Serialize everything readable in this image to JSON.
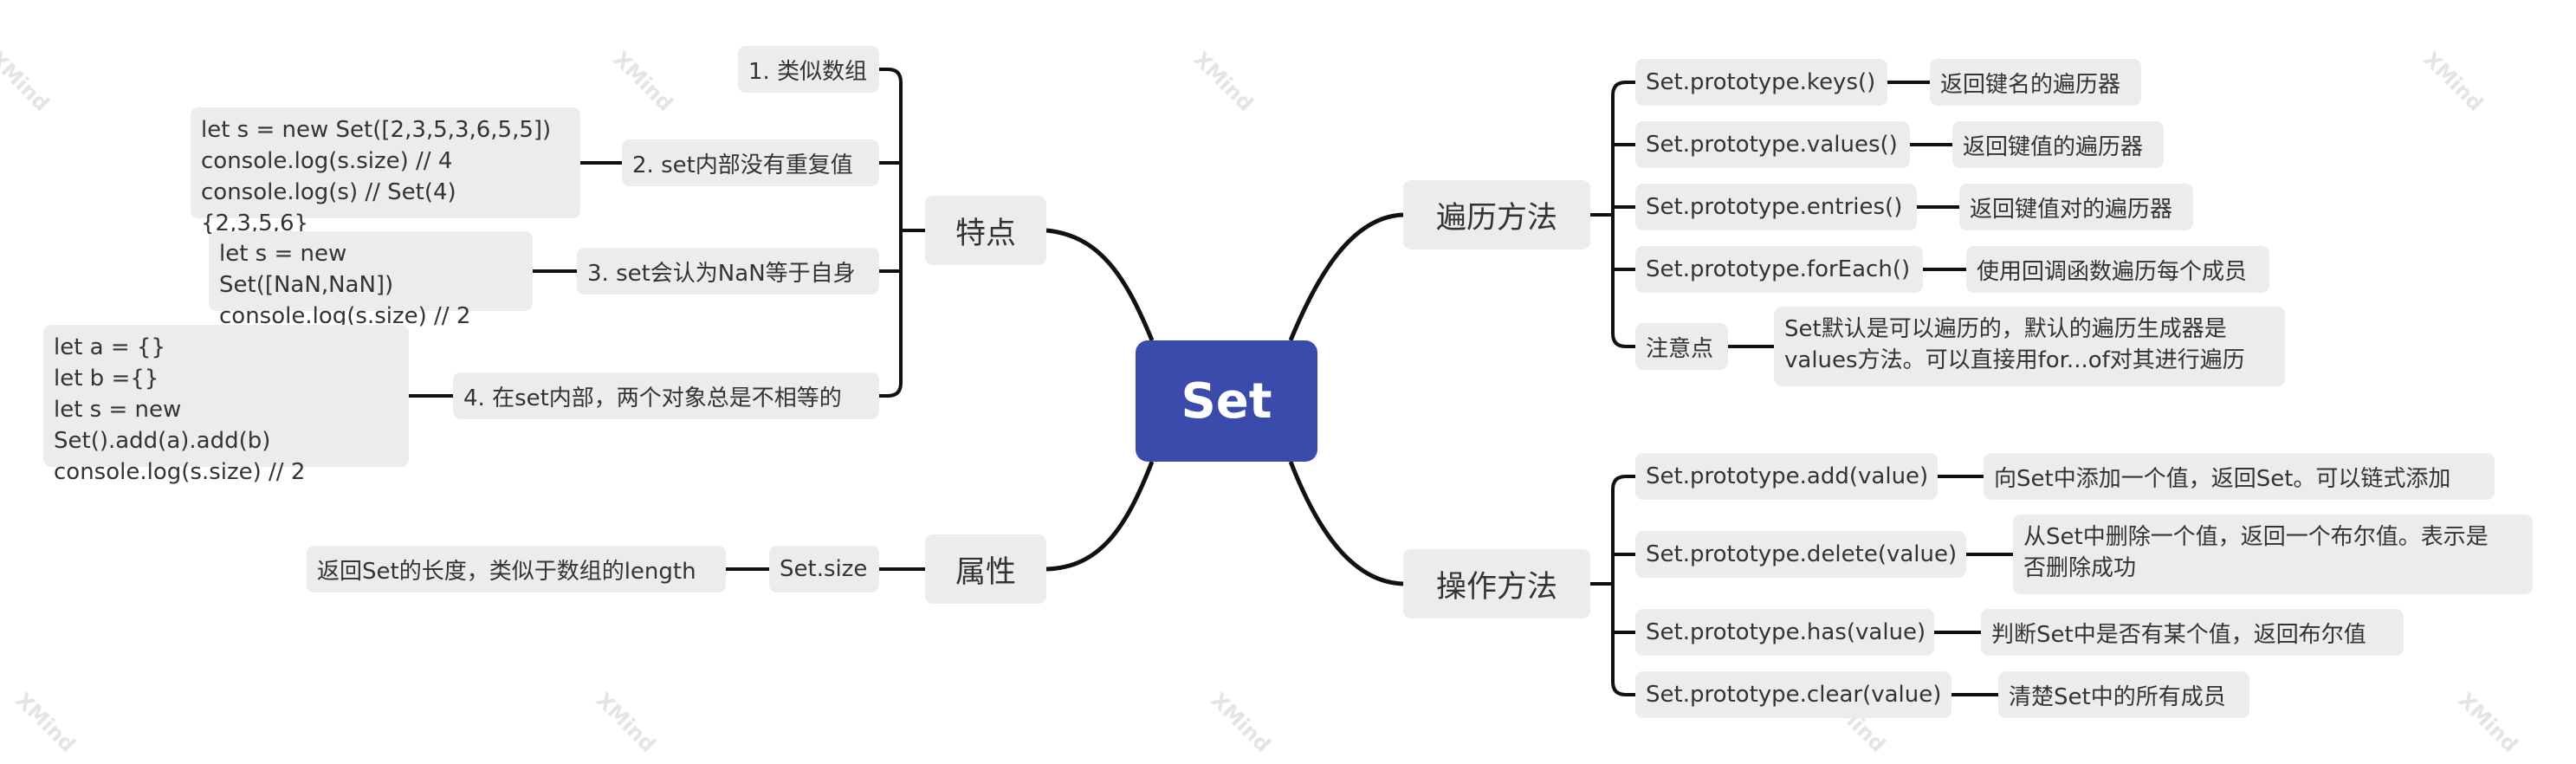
{
  "root": {
    "label": "Set"
  },
  "branches": {
    "tedian": {
      "label": "特点",
      "items": [
        {
          "label": "1. 类似数组"
        },
        {
          "label": "2. set内部没有重复值",
          "example": "let s = new Set([2,3,5,3,6,5,5])\nconsole.log(s.size) // 4\nconsole.log(s) // Set(4) {2,3,5,6}"
        },
        {
          "label": "3. set会认为NaN等于自身",
          "example": "let s = new Set([NaN,NaN])\nconsole.log(s.size) // 2"
        },
        {
          "label": "4. 在set内部，两个对象总是不相等的",
          "example": "let a = {}\nlet b ={}\nlet s = new Set().add(a).add(b)\nconsole.log(s.size) // 2"
        }
      ]
    },
    "shuxing": {
      "label": "属性",
      "items": [
        {
          "label": "Set.size",
          "desc": "返回Set的长度，类似于数组的length"
        }
      ]
    },
    "bianli": {
      "label": "遍历方法",
      "items": [
        {
          "label": "Set.prototype.keys()",
          "desc": "返回键名的遍历器"
        },
        {
          "label": "Set.prototype.values()",
          "desc": "返回键值的遍历器"
        },
        {
          "label": "Set.prototype.entries()",
          "desc": "返回键值对的遍历器"
        },
        {
          "label": "Set.prototype.forEach()",
          "desc": "使用回调函数遍历每个成员"
        },
        {
          "label": "注意点",
          "desc": "Set默认是可以遍历的，默认的遍历生成器是\nvalues方法。可以直接用for...of对其进行遍历"
        }
      ]
    },
    "caozuo": {
      "label": "操作方法",
      "items": [
        {
          "label": "Set.prototype.add(value)",
          "desc": "向Set中添加一个值，返回Set。可以链式添加"
        },
        {
          "label": "Set.prototype.delete(value)",
          "desc": "从Set中删除一个值，返回一个布尔值。表示是\n否删除成功"
        },
        {
          "label": "Set.prototype.has(value)",
          "desc": "判断Set中是否有某个值，返回布尔值"
        },
        {
          "label": "Set.prototype.clear(value)",
          "desc": "清楚Set中的所有成员"
        }
      ]
    }
  },
  "watermark": "XMind",
  "colors": {
    "root": "#3a4bab",
    "node": "#ececec",
    "line": "#111111",
    "text": "#333333"
  }
}
